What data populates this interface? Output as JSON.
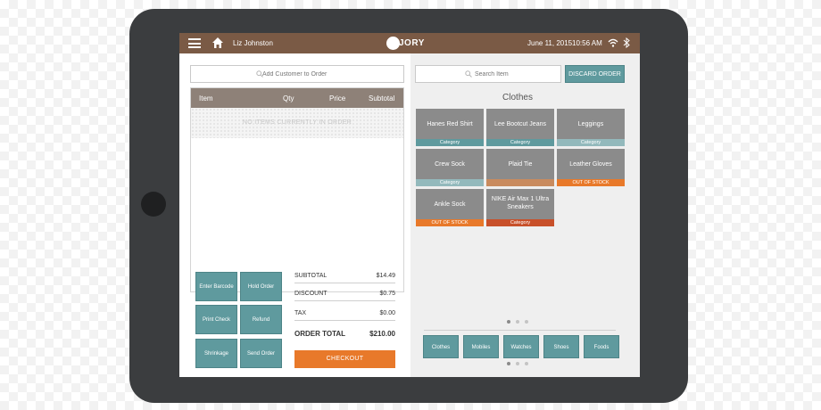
{
  "header": {
    "user_name": "Liz Johnston",
    "brand": "JORY",
    "date": "June 11, 2015",
    "time": "10:56 AM"
  },
  "order": {
    "customer_placeholder": "Add Customer to Order",
    "columns": [
      "Item",
      "Qty",
      "Price",
      "Subtotal"
    ],
    "empty_message": "NO ITEMS CURRENTLY IN ORDER",
    "actions": [
      "Enter Barcode",
      "Hold Order",
      "Print Check",
      "Refund",
      "Shrinkage",
      "Send Order"
    ],
    "totals": [
      {
        "label": "SUBTOTAL",
        "value": "$14.49"
      },
      {
        "label": "DISCOUNT",
        "value": "$0.75"
      },
      {
        "label": "TAX",
        "value": "$0.00"
      }
    ],
    "order_total": {
      "label": "ORDER TOTAL",
      "value": "$210.00"
    },
    "checkout_label": "CHECKOUT"
  },
  "catalog": {
    "search_placeholder": "Search Item",
    "discard_label": "DISCARD ORDER",
    "category_title": "Clothes",
    "items": [
      {
        "name": "Hanes Red Shirt",
        "tag": "Category"
      },
      {
        "name": "Lee Bootcut Jeans",
        "tag": "Category"
      },
      {
        "name": "Leggings",
        "tag": "Category"
      },
      {
        "name": "Crew Sock",
        "tag": "Category"
      },
      {
        "name": "Plaid Tie",
        "tag": ""
      },
      {
        "name": "Leather Gloves",
        "tag": "OUT OF STOCK"
      },
      {
        "name": "Ankle Sock",
        "tag": "OUT OF STOCK"
      },
      {
        "name": "NIKE Air Max 1 Ultra Sneakers",
        "tag": "Category"
      }
    ],
    "categories": [
      "Clothes",
      "Mobiles",
      "Watches",
      "Shoes",
      "Foods"
    ]
  },
  "colors": {
    "header_brown": "#7a5a45",
    "teal": "#5f9a9e",
    "orange": "#e8792a",
    "tile_gray": "#8b8b8b"
  }
}
